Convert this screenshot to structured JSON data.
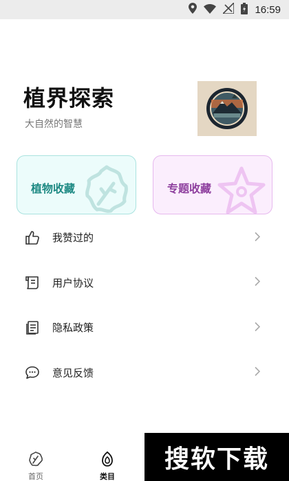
{
  "status_bar": {
    "time": "16:59"
  },
  "header": {
    "title": "植界探索",
    "subtitle": "大自然的智慧"
  },
  "cards": {
    "plants": {
      "label": "植物收藏"
    },
    "topics": {
      "label": "专题收藏"
    }
  },
  "menu": {
    "items": [
      {
        "label": "我赞过的",
        "icon": "thumbs-up-icon"
      },
      {
        "label": "用户协议",
        "icon": "scroll-icon"
      },
      {
        "label": "隐私政策",
        "icon": "document-icon"
      },
      {
        "label": "意见反馈",
        "icon": "chat-icon"
      }
    ]
  },
  "tab_bar": {
    "home": {
      "label": "首页"
    },
    "category": {
      "label": "类目"
    }
  },
  "watermark": {
    "text": "搜软下载"
  }
}
